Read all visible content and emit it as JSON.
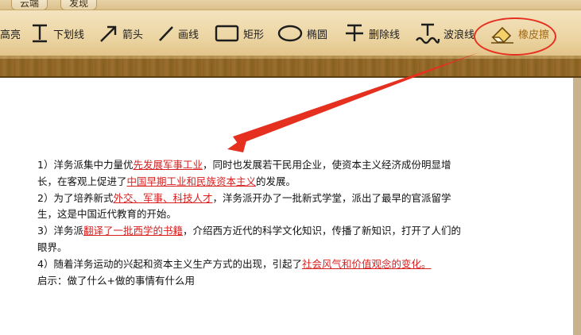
{
  "tabs": [
    "云端",
    "发现"
  ],
  "toolbar": {
    "highlight": "高亮",
    "underline": "下划线",
    "arrow": "箭头",
    "line": "画线",
    "rect": "矩形",
    "ellipse": "椭圆",
    "strikethrough": "删除线",
    "wavy": "波浪线",
    "eraser": "橡皮擦"
  },
  "colors": {
    "accent_red": "#e53020",
    "highlight_text": "#d82020",
    "wood": "#8c6326"
  },
  "doc": {
    "p1": {
      "a": "1）洋务派集中力量优",
      "hl1": "先发展军事工业",
      "b": "，同时也发展若干民用企业，使资本主义经济成份明显增长，在客观上促进了",
      "hl2": "中国早期工业和民族资本主义",
      "c": "的发展。"
    },
    "p2": {
      "a": "2）为了培养新式",
      "hl1": "外交、军事、科技人才",
      "b": "，洋务派开办了一批新式学堂，派出了最早的官派留学生，这是中国近代教育的开始。"
    },
    "p3": {
      "a": "3）洋务派",
      "hl1": "翻译了一批西学的书籍",
      "b": "，介绍西方近代的科学文化知识，传播了新知识，打开了人们的眼界。"
    },
    "p4": {
      "a": "4）随着洋务运动的兴起和资本主义生产方式的出现，引起了",
      "hl1": "社会风气和价值观念的变化。"
    },
    "p5": "启示：做了什么+做的事情有什么用"
  }
}
